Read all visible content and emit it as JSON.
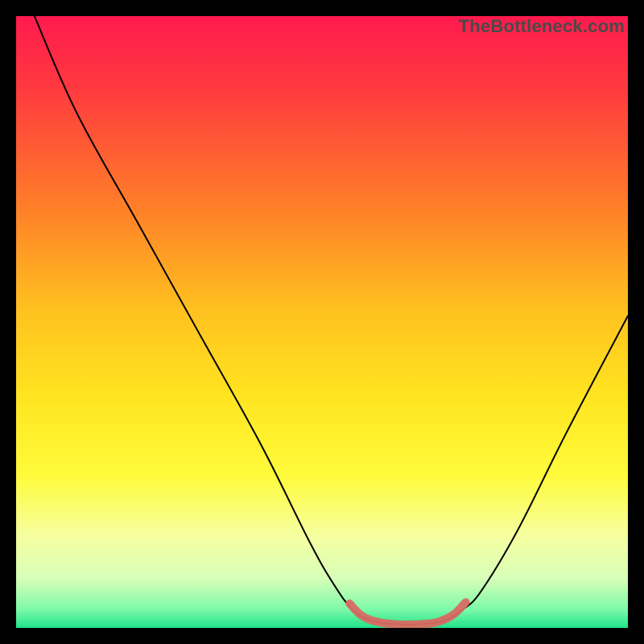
{
  "watermark": "TheBottleneck.com",
  "chart_data": {
    "type": "line",
    "title": "",
    "xlabel": "",
    "ylabel": "",
    "xlim": [
      0,
      100
    ],
    "ylim": [
      0,
      100
    ],
    "background_gradient": {
      "stops": [
        {
          "offset": 0.0,
          "color": "#ff1a4e"
        },
        {
          "offset": 0.12,
          "color": "#ff3a3f"
        },
        {
          "offset": 0.3,
          "color": "#ff7a2a"
        },
        {
          "offset": 0.48,
          "color": "#ffc11f"
        },
        {
          "offset": 0.62,
          "color": "#ffe420"
        },
        {
          "offset": 0.75,
          "color": "#fffb3a"
        },
        {
          "offset": 0.85,
          "color": "#f6ffa0"
        },
        {
          "offset": 0.92,
          "color": "#d6ffb8"
        },
        {
          "offset": 0.97,
          "color": "#7cf9a8"
        },
        {
          "offset": 1.0,
          "color": "#20e38a"
        }
      ]
    },
    "series": [
      {
        "name": "bottleneck-curve",
        "color": "#000000",
        "width": 2,
        "points": [
          {
            "x": 3,
            "y": 100
          },
          {
            "x": 10,
            "y": 84
          },
          {
            "x": 20,
            "y": 66
          },
          {
            "x": 30,
            "y": 48
          },
          {
            "x": 40,
            "y": 30
          },
          {
            "x": 48,
            "y": 14
          },
          {
            "x": 52,
            "y": 7
          },
          {
            "x": 55,
            "y": 3
          },
          {
            "x": 58,
            "y": 1.2
          },
          {
            "x": 62,
            "y": 0.6
          },
          {
            "x": 66,
            "y": 0.6
          },
          {
            "x": 70,
            "y": 1.2
          },
          {
            "x": 73,
            "y": 3
          },
          {
            "x": 76,
            "y": 6
          },
          {
            "x": 82,
            "y": 16
          },
          {
            "x": 90,
            "y": 32
          },
          {
            "x": 100,
            "y": 51
          }
        ]
      },
      {
        "name": "optimal-band",
        "color": "#d86a63",
        "width": 10,
        "linecap": "round",
        "points": [
          {
            "x": 54.5,
            "y": 4.0
          },
          {
            "x": 56.5,
            "y": 2.0
          },
          {
            "x": 59.0,
            "y": 1.0
          },
          {
            "x": 62.0,
            "y": 0.6
          },
          {
            "x": 66.0,
            "y": 0.6
          },
          {
            "x": 69.0,
            "y": 1.0
          },
          {
            "x": 71.5,
            "y": 2.2
          },
          {
            "x": 73.5,
            "y": 4.2
          }
        ]
      }
    ]
  }
}
